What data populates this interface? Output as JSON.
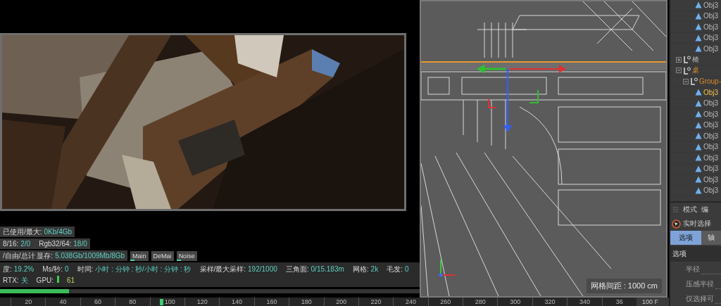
{
  "render_view": {
    "kind": "picture"
  },
  "memory_stats": [
    [
      {
        "label": "已使用/最大:",
        "value": "0Kb/4Gb"
      }
    ],
    [
      {
        "label": "8/16:",
        "value": "2/0"
      },
      {
        "label": "Rgb32/64:",
        "value": "18/0"
      }
    ],
    [
      {
        "label": "/自由/总计 显存:",
        "value": "5.038Gb/1009Mb/8Gb"
      }
    ]
  ],
  "channel_tabs": [
    {
      "label": "Main",
      "active": true
    },
    {
      "label": "DeMai",
      "active": false
    },
    {
      "label": "Noise",
      "active": true
    }
  ],
  "status_line": [
    {
      "kind": "reading",
      "label": "度:",
      "value": "19.2%"
    },
    {
      "kind": "reading",
      "label": "Ms/秒:",
      "value": "0"
    },
    {
      "kind": "reading",
      "label": "时间:",
      "value": "小时 : 分钟 : 秒/小时 : 分钟 : 秒"
    },
    {
      "kind": "reading",
      "label": "采样/最大采样:",
      "value": "192/1000"
    },
    {
      "kind": "reading",
      "label": "三角面:",
      "value": "0/15.183m"
    },
    {
      "kind": "reading",
      "label": "网格:",
      "value": "2k"
    },
    {
      "kind": "reading",
      "label": "毛发:",
      "value": "0"
    },
    {
      "kind": "reading",
      "label": "RTX:",
      "value": "关"
    },
    {
      "kind": "meter",
      "label": "GPU:",
      "value": "61"
    }
  ],
  "progress": {
    "level": 0.165
  },
  "viewport": {
    "grid_spacing": "网格间距 : 1000 cm"
  },
  "timeline": {
    "ticks": [
      {
        "label": "20",
        "current": false
      },
      {
        "label": "40",
        "current": false
      },
      {
        "label": "60",
        "current": false
      },
      {
        "label": "80",
        "current": false
      },
      {
        "label": "100",
        "current": true
      },
      {
        "label": "120",
        "current": false
      },
      {
        "label": "140",
        "current": false
      },
      {
        "label": "160",
        "current": false
      },
      {
        "label": "180",
        "current": false
      },
      {
        "label": "200",
        "current": false
      },
      {
        "label": "220",
        "current": false
      },
      {
        "label": "240",
        "current": false
      },
      {
        "label": "260",
        "current": false
      },
      {
        "label": "280",
        "current": false
      },
      {
        "label": "300",
        "current": false
      },
      {
        "label": "320",
        "current": false
      },
      {
        "label": "340",
        "current": false
      },
      {
        "label": "36",
        "current": false
      }
    ],
    "frame_field": "100 F"
  },
  "object_tree": {
    "continued_items": [
      {
        "label": "Obj3",
        "kind": "mesh",
        "selected": false
      },
      {
        "label": "Obj3",
        "kind": "mesh",
        "selected": false
      },
      {
        "label": "Obj3",
        "kind": "mesh",
        "selected": false
      },
      {
        "label": "Obj3",
        "kind": "mesh",
        "selected": false
      },
      {
        "label": "Obj3",
        "kind": "mesh",
        "selected": false
      }
    ],
    "nodes": [
      {
        "label": "椅",
        "kind": "null",
        "expanded": false,
        "selected": false,
        "highlighted": false
      },
      {
        "label": "桌",
        "kind": "null",
        "expanded": true,
        "selected": false,
        "highlighted": true,
        "children": [
          {
            "label": "Group-",
            "kind": "null",
            "expanded": true,
            "selected": false,
            "highlighted": true,
            "children": [
              {
                "label": "Obj3",
                "kind": "mesh",
                "selected": true
              },
              {
                "label": "Obj3",
                "kind": "mesh",
                "selected": false
              },
              {
                "label": "Obj3",
                "kind": "mesh",
                "selected": false
              },
              {
                "label": "Obj3",
                "kind": "mesh",
                "selected": false
              },
              {
                "label": "Obj3",
                "kind": "mesh",
                "selected": false
              },
              {
                "label": "Obj3",
                "kind": "mesh",
                "selected": false
              },
              {
                "label": "Obj3",
                "kind": "mesh",
                "selected": false
              },
              {
                "label": "Obj3",
                "kind": "mesh",
                "selected": false
              },
              {
                "label": "Obj3",
                "kind": "mesh",
                "selected": false
              },
              {
                "label": "Obj3",
                "kind": "mesh",
                "selected": false
              }
            ]
          }
        ]
      }
    ]
  },
  "attributes": {
    "menu": [
      "模式",
      "编"
    ],
    "tool": "实时选择",
    "tabs": [
      {
        "label": "选项",
        "selected": true
      },
      {
        "label": "轴",
        "selected": false
      }
    ],
    "section": "选项",
    "fields": [
      "半径",
      "压感半径",
      "仅选择可"
    ]
  }
}
